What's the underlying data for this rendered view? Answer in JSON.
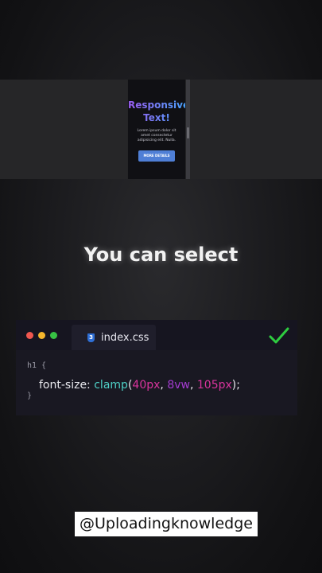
{
  "preview": {
    "title_line1": "Responsive",
    "title_line2": "Text!",
    "body": "Lorem ipsum dolor sit amet consectetur adipisicing elit. Nulla.",
    "button": "MORE DETAILS"
  },
  "headline": "You can select",
  "editor": {
    "tab_label": "index.css",
    "css_icon_glyph": "3",
    "selector_line": "h1 {",
    "code_property": "font-size: ",
    "code_function": "clamp",
    "code_open_paren": "(",
    "code_arg1": "40px",
    "code_sep1": ", ",
    "code_arg2": "8vw",
    "code_sep2": ", ",
    "code_arg3": "105px",
    "code_close": ");",
    "closing_brace": "}"
  },
  "icons": {
    "traffic_lights": [
      "red-dot-icon",
      "yellow-dot-icon",
      "green-dot-icon"
    ],
    "check": "checkmark-icon",
    "css_file": "css-file-icon"
  },
  "colors": {
    "red": "#f0574f",
    "yellow": "#f5b72c",
    "green": "#37c244",
    "check": "#2ecc40",
    "function": "#4fd1c7",
    "number": "#d9349d",
    "button": "#4f7fd6"
  },
  "watermark": "@Uploadingknowledge"
}
